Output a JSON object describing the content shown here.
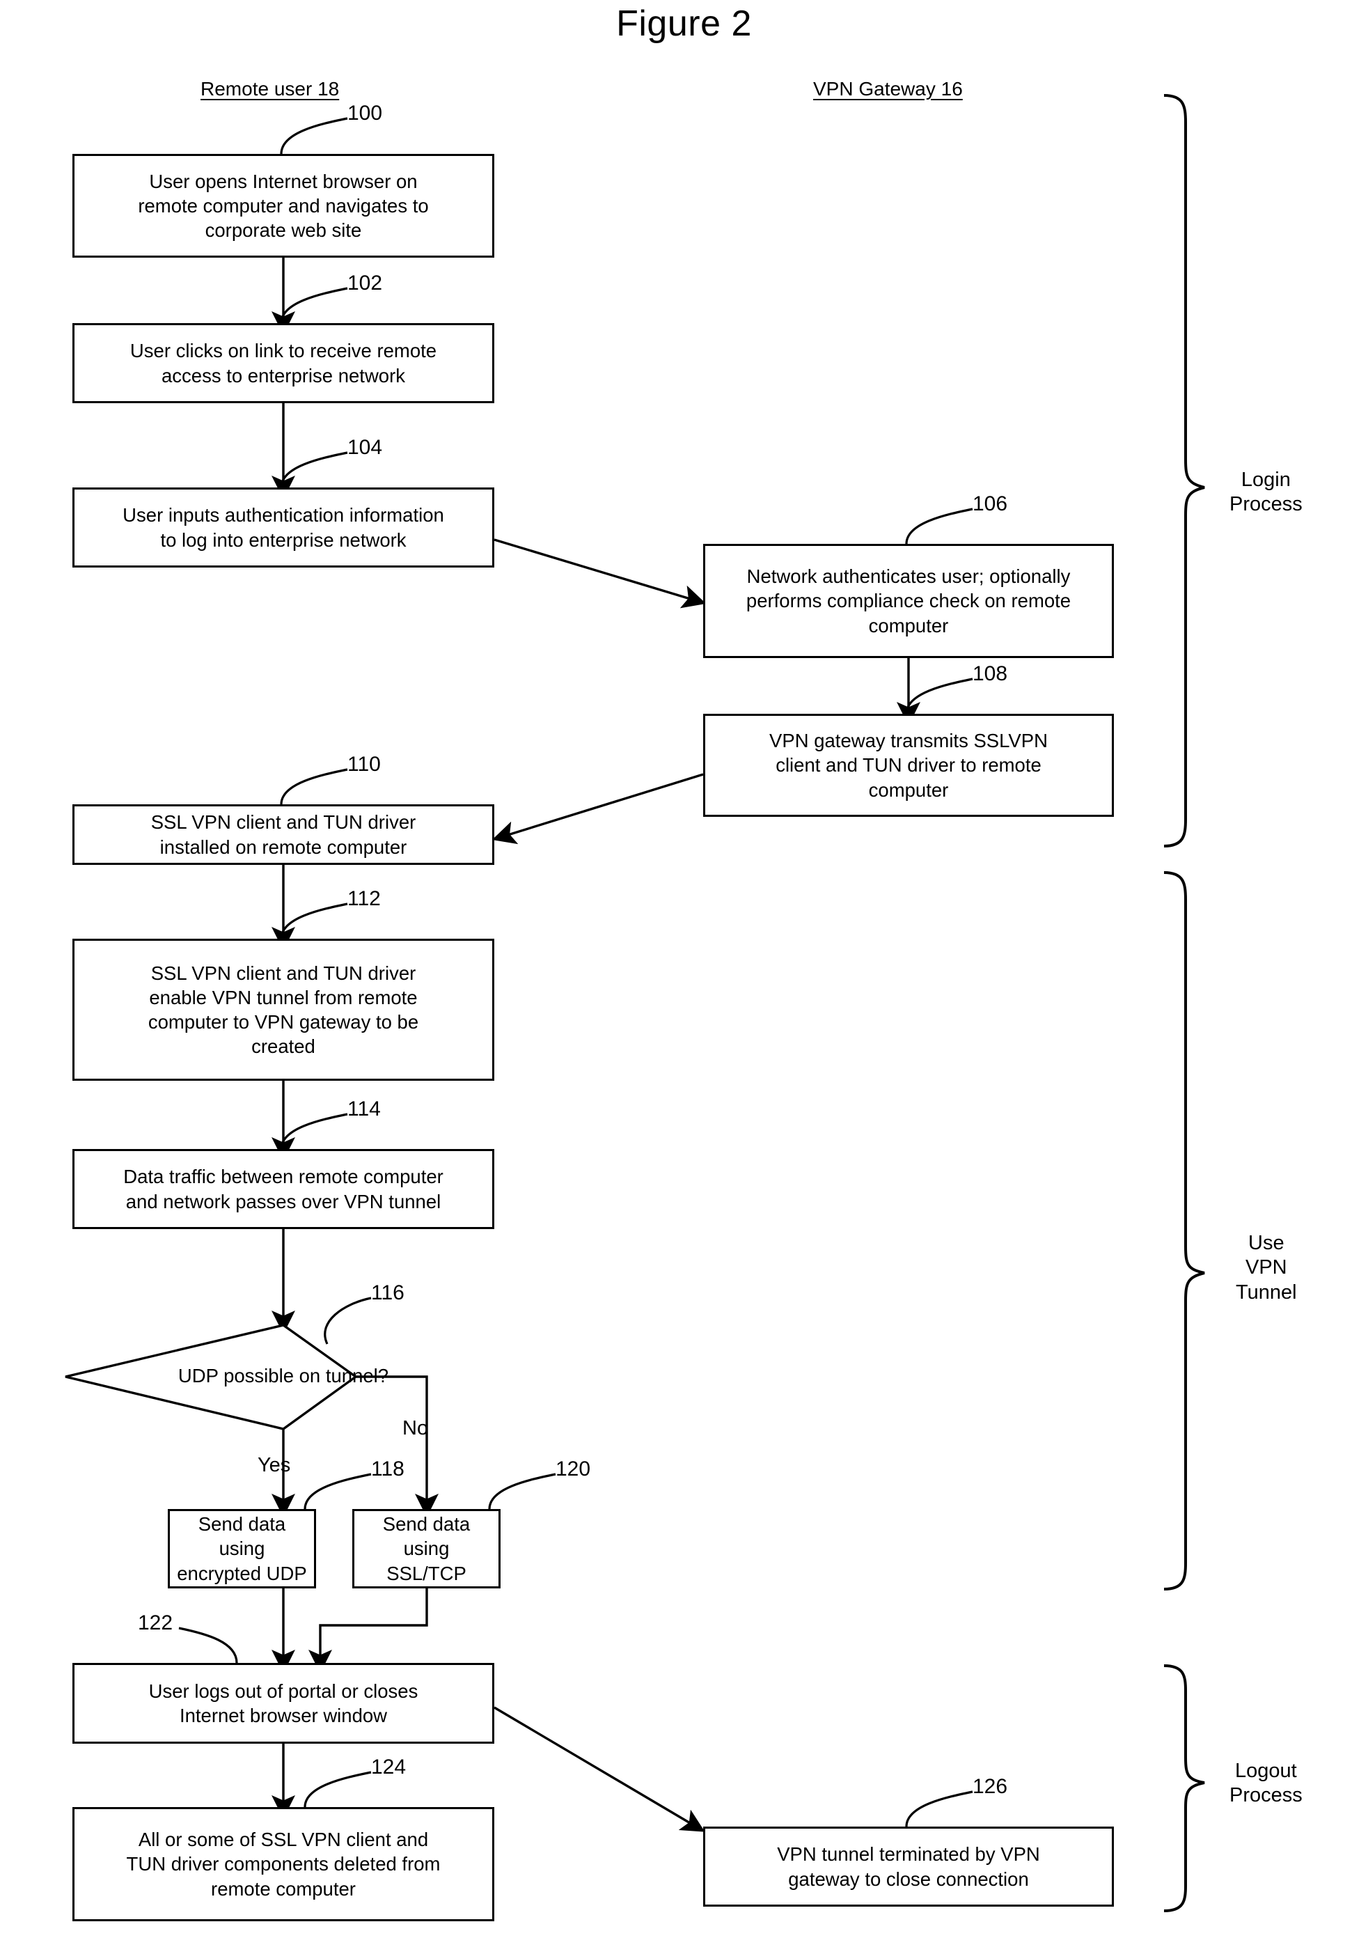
{
  "figure": {
    "title": "Figure 2"
  },
  "columns": [
    {
      "id": "remote-user",
      "label": "Remote user 18"
    },
    {
      "id": "vpn-gateway",
      "label": "VPN Gateway 16"
    }
  ],
  "nodes": [
    {
      "ref": "100",
      "column": "remote-user",
      "shape": "process",
      "lines": [
        "User opens Internet browser on",
        "remote computer and navigates to",
        "corporate web site"
      ]
    },
    {
      "ref": "102",
      "column": "remote-user",
      "shape": "process",
      "lines": [
        "User clicks on link to receive remote",
        "access to enterprise network"
      ]
    },
    {
      "ref": "104",
      "column": "remote-user",
      "shape": "process",
      "lines": [
        "User inputs authentication information",
        "to log into enterprise network"
      ]
    },
    {
      "ref": "106",
      "column": "vpn-gateway",
      "shape": "process",
      "lines": [
        "Network authenticates user; optionally",
        "performs compliance check on remote",
        "computer"
      ]
    },
    {
      "ref": "108",
      "column": "vpn-gateway",
      "shape": "process",
      "lines": [
        "VPN gateway transmits SSLVPN",
        "client and TUN driver to remote",
        "computer"
      ]
    },
    {
      "ref": "110",
      "column": "remote-user",
      "shape": "process",
      "lines": [
        "SSL VPN client and TUN driver",
        "installed on remote computer"
      ]
    },
    {
      "ref": "112",
      "column": "remote-user",
      "shape": "process",
      "lines": [
        "SSL VPN client and TUN driver",
        "enable VPN tunnel from remote",
        "computer to VPN gateway to be",
        "created"
      ]
    },
    {
      "ref": "114",
      "column": "remote-user",
      "shape": "process",
      "lines": [
        "Data traffic between remote computer",
        "and network passes over VPN tunnel"
      ]
    },
    {
      "ref": "116",
      "column": "remote-user",
      "shape": "decision",
      "lines": [
        "UDP possible on tunnel?"
      ]
    },
    {
      "ref": "118",
      "column": "remote-user",
      "shape": "process",
      "lines": [
        "Send data using",
        "encrypted UDP"
      ]
    },
    {
      "ref": "120",
      "column": "remote-user",
      "shape": "process",
      "lines": [
        "Send data using",
        "SSL/TCP"
      ]
    },
    {
      "ref": "122",
      "column": "remote-user",
      "shape": "process",
      "lines": [
        "User logs out of portal or closes",
        "Internet browser window"
      ]
    },
    {
      "ref": "124",
      "column": "remote-user",
      "shape": "process",
      "lines": [
        "All or some of SSL VPN client and",
        "TUN driver components deleted from",
        "remote computer"
      ]
    },
    {
      "ref": "126",
      "column": "vpn-gateway",
      "shape": "process",
      "lines": [
        "VPN tunnel terminated by VPN",
        "gateway to close connection"
      ]
    }
  ],
  "edge_labels": {
    "yes": "Yes",
    "no": "No"
  },
  "brackets": [
    {
      "id": "login",
      "lines": [
        "Login",
        "Process"
      ]
    },
    {
      "id": "use-vpn-tunnel",
      "lines": [
        "Use",
        "VPN",
        "Tunnel"
      ]
    },
    {
      "id": "logout",
      "lines": [
        "Logout",
        "Process"
      ]
    }
  ],
  "style": {
    "ink": "#000000",
    "paper": "#ffffff"
  }
}
